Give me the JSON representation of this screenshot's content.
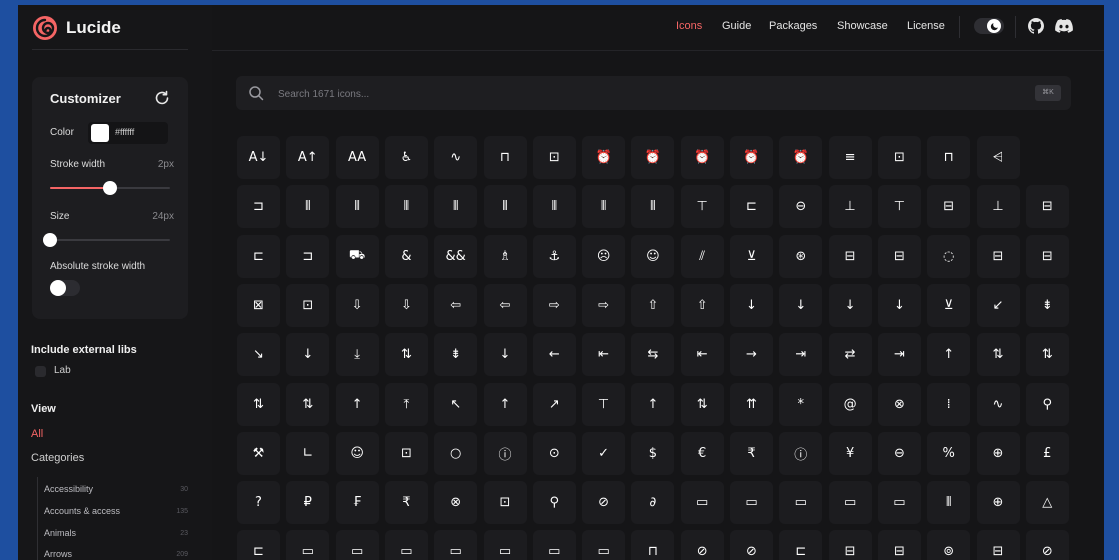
{
  "app": {
    "name": "Lucide"
  },
  "colors": {
    "accent": "#f56565",
    "background": "#151517",
    "tile": "#1c1c1f"
  },
  "nav": {
    "items": [
      {
        "label": "Icons",
        "active": true
      },
      {
        "label": "Guide",
        "active": false
      },
      {
        "label": "Packages",
        "active": false
      },
      {
        "label": "Showcase",
        "active": false
      },
      {
        "label": "License",
        "active": false
      }
    ],
    "icons": [
      "theme-toggle-icon",
      "github-icon",
      "discord-icon"
    ]
  },
  "customizer": {
    "title": "Customizer",
    "color_label": "Color",
    "color_value": "#ffffff",
    "stroke_label": "Stroke width",
    "stroke_value": "2px",
    "stroke_level": 0.5,
    "size_label": "Size",
    "size_value": "24px",
    "size_level": 0,
    "absolute_label": "Absolute stroke width",
    "absolute_on": false
  },
  "external": {
    "title": "Include external libs",
    "lab_label": "Lab"
  },
  "view": {
    "title": "View",
    "all_label": "All",
    "categories_label": "Categories",
    "categories": [
      {
        "name": "Accessibility",
        "count": "30"
      },
      {
        "name": "Accounts & access",
        "count": "135"
      },
      {
        "name": "Animals",
        "count": "23"
      },
      {
        "name": "Arrows",
        "count": "209"
      }
    ]
  },
  "search": {
    "placeholder": "Search 1671 icons...",
    "shortcut": "⌘K"
  },
  "icons": [
    [
      "A↓",
      "A↑",
      "AA",
      "♿",
      "∿",
      "⊓",
      "⊡",
      "⏰",
      "⏰",
      "⏰",
      "⏰",
      "⏰",
      "≡",
      "⊡",
      "⊓",
      "⩤"
    ],
    [
      "⊐",
      "⫴",
      "⫴",
      "⫴",
      "⫴",
      "⫴",
      "⫴",
      "⫴",
      "⫴",
      "⊤",
      "⊏",
      "⊖",
      "⊥",
      "⊤",
      "⊟",
      "⊥",
      "⊟"
    ],
    [
      "⊏",
      "⊐",
      "⛟",
      "&",
      "&&",
      "♗",
      "⚓",
      "☹",
      "☺",
      "⫽",
      "⊻",
      "⊛",
      "⊟",
      "⊟",
      "◌",
      "⊟",
      "⊟"
    ],
    [
      "⊠",
      "⊡",
      "⇩",
      "⇩",
      "⇦",
      "⇦",
      "⇨",
      "⇨",
      "⇧",
      "⇧",
      "↓",
      "↓",
      "↓",
      "↓",
      "⊻",
      "↙",
      "⇟"
    ],
    [
      "↘",
      "↓",
      "⤓",
      "⇅",
      "⇟",
      "↓",
      "←",
      "⇤",
      "⇆",
      "⇤",
      "→",
      "⇥",
      "⇄",
      "⇥",
      "↑",
      "⇅",
      "⇅"
    ],
    [
      "⇅",
      "⇅",
      "↑",
      "⤒",
      "↖",
      "↑",
      "↗",
      "⊤",
      "↑",
      "⇅",
      "⇈",
      "*",
      "@",
      "⊗",
      "⁞",
      "∿",
      "⚲"
    ],
    [
      "⚒",
      "∟",
      "☺",
      "⊡",
      "○",
      "ⓘ",
      "⊙",
      "✓",
      "$",
      "€",
      "₹",
      "ⓘ",
      "¥",
      "⊖",
      "%",
      "⊕",
      "£"
    ],
    [
      "?",
      "₽",
      "₣",
      "₹",
      "⊗",
      "⊡",
      "⚲",
      "⊘",
      "∂",
      "▭",
      "▭",
      "▭",
      "▭",
      "▭",
      "⦀",
      "⊕",
      "△"
    ],
    [
      "⊏",
      "▭",
      "▭",
      "▭",
      "▭",
      "▭",
      "▭",
      "▭",
      "⊓",
      "⊘",
      "⊘",
      "⊏",
      "⊟",
      "⊟",
      "⊚",
      "⊟",
      "⊘"
    ]
  ]
}
